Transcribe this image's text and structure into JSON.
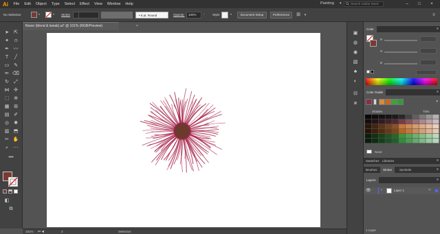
{
  "app": {
    "logo_text": "Ai",
    "menu": [
      "File",
      "Edit",
      "Object",
      "Type",
      "Select",
      "Effect",
      "View",
      "Window",
      "Help"
    ],
    "workspace": "Painting",
    "search_placeholder": "Search Adobe Stock"
  },
  "control_bar": {
    "selection_label": "No Selection",
    "fill_color": "#7a3a33",
    "stroke_label": "Stroke",
    "brush_definition": "5 pt. Round",
    "opacity_label": "Opacity:",
    "opacity_value": "100%",
    "style_label": "Style:",
    "document_setup_label": "Document Setup",
    "preferences_label": "Preferences"
  },
  "document": {
    "tab_title": "flower (blend & tweak).ai* @ 101% (RGB/Preview)",
    "close_glyph": "×"
  },
  "status_bar": {
    "zoom": "101%",
    "page": "2",
    "current_tool": "Selection"
  },
  "panels": {
    "color": {
      "tab_label": "Color",
      "channels": [
        "R",
        "G",
        "B"
      ]
    },
    "color_guide": {
      "tab_label": "Color Guide",
      "shades_label": "Shades",
      "tints_label": "Tints",
      "none_label": "None",
      "harmony_chips": [
        "#8a2f45",
        "#d6d6d6",
        "#d98a3a",
        "#c46a1e",
        "#3aa534",
        "#2f9b3d"
      ]
    },
    "swatches_group": {
      "tabs": [
        "Swatches",
        "Libraries"
      ]
    },
    "brushes_group": {
      "tabs": [
        "Brushes",
        "Stroke",
        "Symbols"
      ],
      "active_tab": "Stroke"
    },
    "layers": {
      "tab_label": "Layers",
      "layer_name": "Layer 1",
      "layer_count": "1 Layer"
    }
  },
  "colors": {
    "flower_petal": "#a8274e",
    "flower_center": "#6b3a2c",
    "chrome_dark": "#323232",
    "chrome_mid": "#424242",
    "chrome_bg": "#535353",
    "accent_layer": "#4b6cff"
  }
}
